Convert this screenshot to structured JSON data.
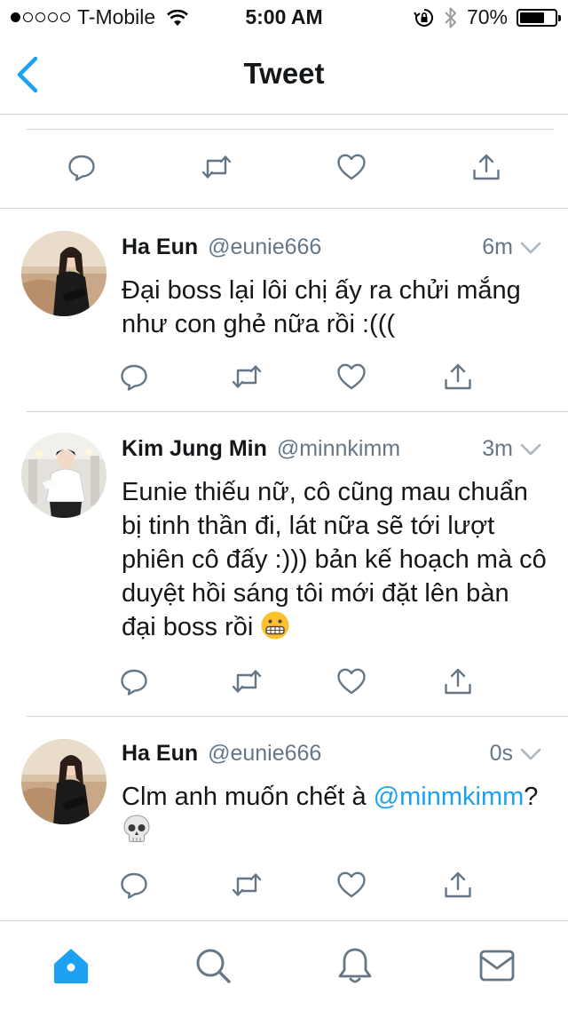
{
  "status_bar": {
    "carrier": "T-Mobile",
    "time": "5:00 AM",
    "battery_percent": "70%",
    "battery_level": 0.7,
    "signal_bars": 1
  },
  "nav": {
    "title": "Tweet",
    "back_icon": "chevron-left-icon"
  },
  "colors": {
    "accent": "#1da1f2",
    "text": "#14171a",
    "secondary": "#657786",
    "divider": "#cfd3d6"
  },
  "tweets": [
    {
      "name": "Ha Eun",
      "handle": "@eunie666",
      "time": "6m",
      "text": "Đại boss lại lôi chị ấy ra chửi mắng như con ghẻ nữa rồi :((("
    },
    {
      "name": "Kim Jung Min",
      "handle": "@minnkimm",
      "time": "3m",
      "text": "Eunie thiếu nữ, cô cũng mau chuẩn bị tinh thần đi, lát nữa sẽ tới lượt phiên cô đấy :))) bản kế hoạch mà cô duyệt hồi sáng tôi mới đặt lên bàn đại boss rồi",
      "emoji": "grimacing-face"
    },
    {
      "name": "Ha Eun",
      "handle": "@eunie666",
      "time": "0s",
      "text_before": "Clm anh muốn chết à ",
      "mention": "@minmkimm",
      "text_after": "? ",
      "emoji": "skull"
    }
  ],
  "tab_bar": {
    "tabs": [
      "home-icon",
      "search-icon",
      "notifications-bell-icon",
      "messages-envelope-icon"
    ],
    "active": "home-icon"
  }
}
